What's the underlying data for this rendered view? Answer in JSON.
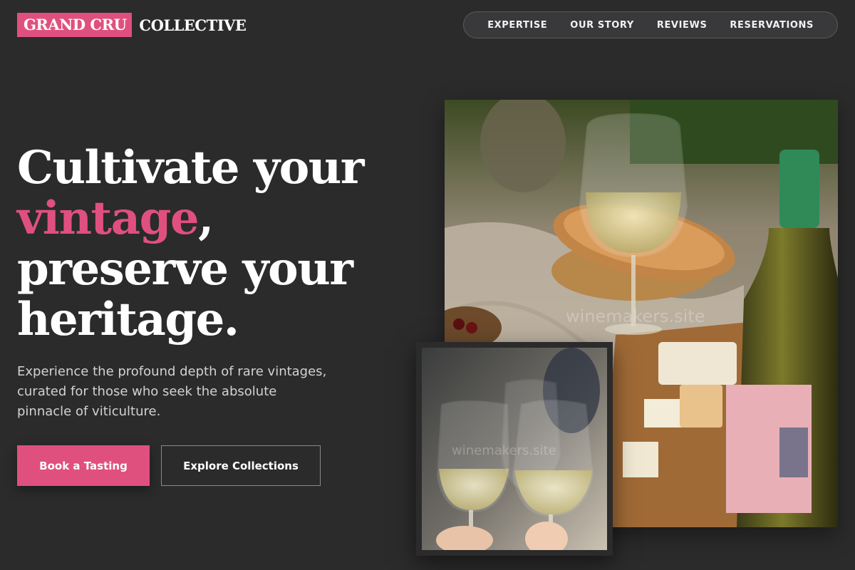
{
  "brand": {
    "badge": "GRAND CRU",
    "rest": "COLLECTIVE",
    "accent_color": "#e0507f"
  },
  "nav": {
    "items": [
      "EXPERTISE",
      "OUR STORY",
      "REVIEWS",
      "RESERVATIONS"
    ]
  },
  "hero": {
    "line1": "Cultivate your",
    "accent_word": "vintage",
    "comma": ",",
    "line3": "preserve your",
    "line4": "heritage.",
    "subtitle": "Experience the profound depth of rare vintages, curated for those who seek the absolute pinnacle of viticulture."
  },
  "buttons": {
    "primary": "Book a Tasting",
    "secondary": "Explore Collections"
  },
  "images": {
    "main_watermark": "winemakers.site",
    "small_watermark": "winemakers.site"
  }
}
